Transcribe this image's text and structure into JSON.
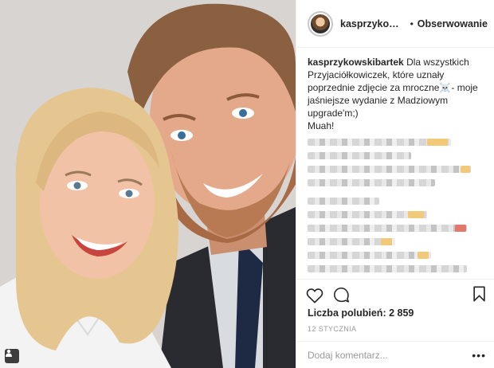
{
  "post": {
    "username": "kasprzykowski...",
    "separator": "•",
    "follow_label": "Obserwowanie"
  },
  "caption": {
    "user": "kasprzykowskibartek",
    "text": "Dla wszystkich Przyjaciółkowiczek, które uznały poprzednie zdjęcie za mroczne☠️- moje jaśniejsze wydanie z Madziowym upgrade'm;)",
    "line2": "Muah!"
  },
  "likes_label": "Liczba polubień: 2 859",
  "date": "12 STYCZNIA",
  "comment": {
    "placeholder": "Dodaj komentarz...",
    "more": "•••"
  },
  "icons": {
    "like": "heart-icon",
    "comment": "speech-bubble-icon",
    "save": "bookmark-icon",
    "tagged": "user-tag-icon"
  },
  "colors": {
    "text": "#262626",
    "muted": "#999999",
    "border": "#efefef"
  }
}
